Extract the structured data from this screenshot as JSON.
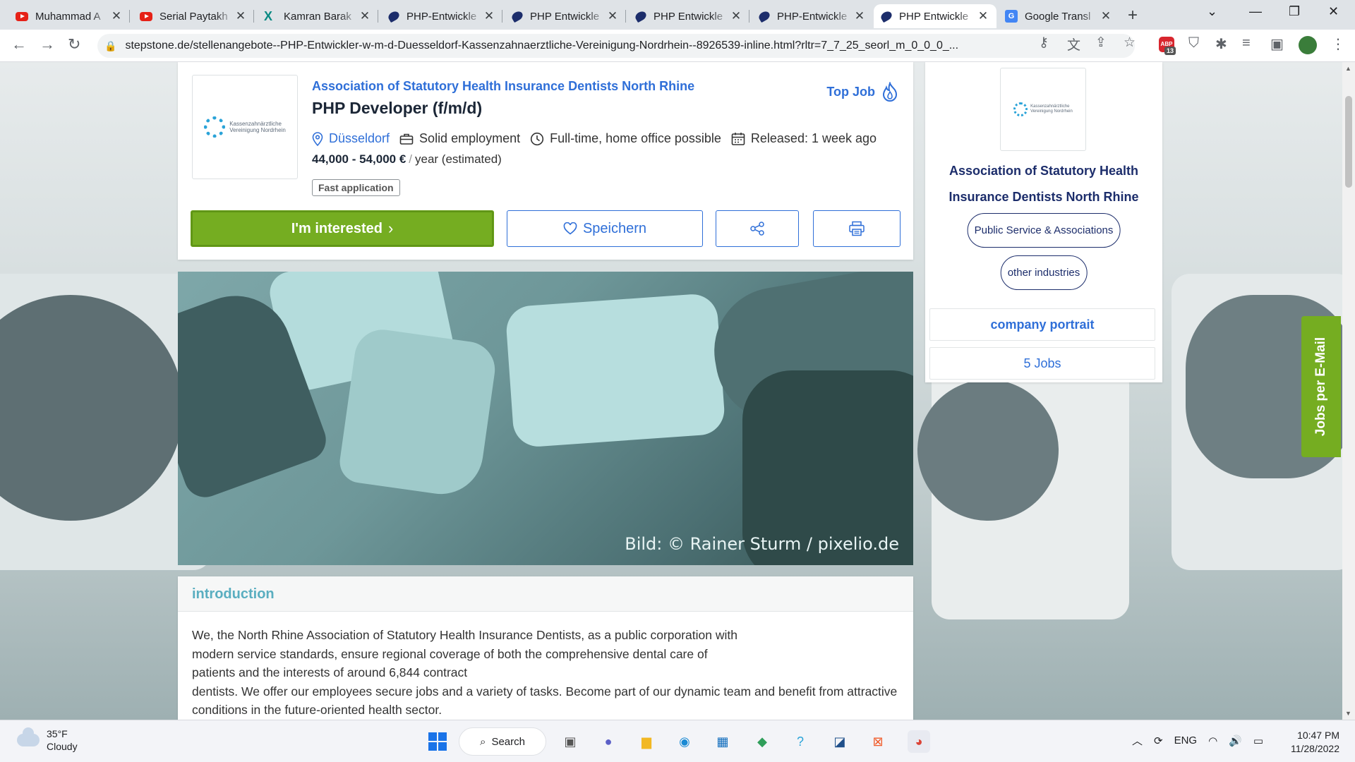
{
  "browser": {
    "tabs": [
      {
        "title": "Muhammad A",
        "icon": "youtube-icon"
      },
      {
        "title": "Serial Paytakh",
        "icon": "youtube-icon"
      },
      {
        "title": "Kamran Barak",
        "icon": "xing-icon"
      },
      {
        "title": "PHP-Entwickle",
        "icon": "stepstone-icon"
      },
      {
        "title": "PHP Entwickle",
        "icon": "stepstone-icon"
      },
      {
        "title": "PHP Entwickle",
        "icon": "stepstone-icon"
      },
      {
        "title": "PHP-Entwickle",
        "icon": "stepstone-icon"
      },
      {
        "title": "PHP Entwickle",
        "icon": "stepstone-icon",
        "active": true
      },
      {
        "title": "Google Transl",
        "icon": "google-translate-icon"
      }
    ],
    "url": "stepstone.de/stellenangebote--PHP-Entwickler-w-m-d-Duesseldorf-Kassenzahnaerztliche-Vereinigung-Nordrhein--8926539-inline.html?rltr=7_7_25_seorl_m_0_0_0_...",
    "extension_badge": "13",
    "extension_label": "ABP"
  },
  "job": {
    "company": "Association of Statutory Health Insurance Dentists North Rhine",
    "title": "PHP Developer (f/m/d)",
    "top_job_label": "Top Job",
    "location": "Düsseldorf",
    "employment": "Solid employment",
    "schedule": "Full-time, home office possible",
    "released": "Released: 1 week ago",
    "salary_range": "44,000 - 54,000 €",
    "salary_unit": "year (estimated)",
    "fast_application": "Fast application",
    "logo_text_line1": "Kassenzahnärztliche",
    "logo_text_line2": "Vereinigung Nordrhein"
  },
  "actions": {
    "interested": "I'm interested",
    "save": "Speichern"
  },
  "hero": {
    "credit": "Bild: © Rainer Sturm / pixelio.de"
  },
  "intro": {
    "heading": "introduction",
    "line1": "We, the North Rhine Association of Statutory Health Insurance Dentists, as a public corporation with",
    "line2": "modern service standards, ensure regional coverage of both the comprehensive dental care of",
    "line3": "patients and the interests of around 6,844 contract",
    "line4": "dentists. We offer our employees secure jobs and a variety of tasks. Become part of our dynamic team and benefit from attractive",
    "line5": "conditions in the future-oriented health sector."
  },
  "sidebar": {
    "company": "Association of Statutory Health Insurance Dentists North Rhine",
    "tag1": "Public Service & Associations",
    "tag2": "other industries",
    "portrait": "company portrait",
    "jobs": "5 Jobs",
    "jobs_email": "Jobs per E-Mail"
  },
  "taskbar": {
    "temperature": "35°F",
    "weather": "Cloudy",
    "search": "Search",
    "language": "ENG",
    "time": "10:47 PM",
    "date": "11/28/2022"
  }
}
